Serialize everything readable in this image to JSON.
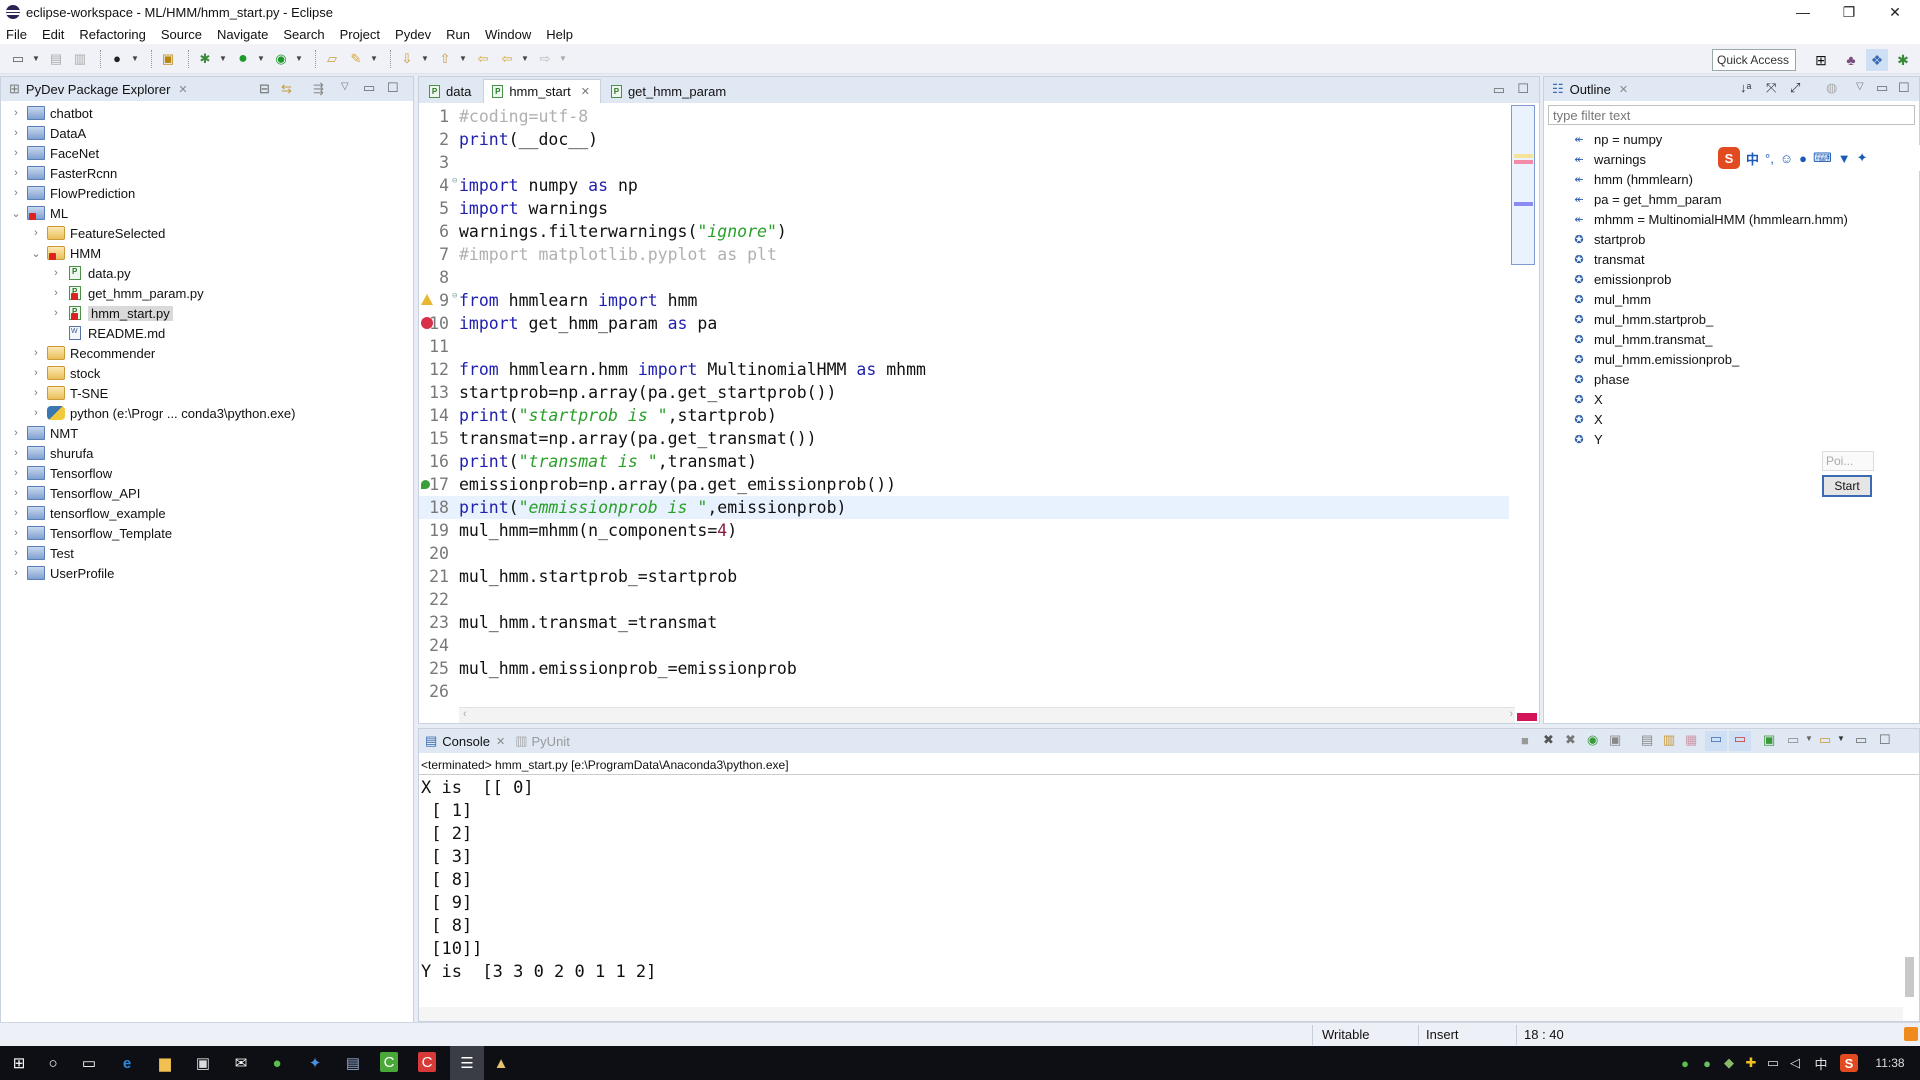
{
  "window": {
    "title": "eclipse-workspace - ML/HMM/hmm_start.py - Eclipse",
    "minimize": "—",
    "restore": "❐",
    "close": "✕"
  },
  "menu": [
    "File",
    "Edit",
    "Refactoring",
    "Source",
    "Navigate",
    "Search",
    "Project",
    "Pydev",
    "Run",
    "Window",
    "Help"
  ],
  "toolbar": {
    "quick_access": "Quick Access"
  },
  "explorer": {
    "title": "PyDev Package Explorer",
    "items": [
      {
        "label": "chatbot",
        "depth": 0,
        "type": "proj",
        "expanded": false
      },
      {
        "label": "DataA",
        "depth": 0,
        "type": "proj",
        "expanded": false
      },
      {
        "label": "FaceNet",
        "depth": 0,
        "type": "proj",
        "expanded": false
      },
      {
        "label": "FasterRcnn",
        "depth": 0,
        "type": "proj",
        "expanded": false
      },
      {
        "label": "FlowPrediction",
        "depth": 0,
        "type": "proj",
        "expanded": false
      },
      {
        "label": "ML",
        "depth": 0,
        "type": "proj",
        "expanded": true,
        "error": true
      },
      {
        "label": "FeatureSelected",
        "depth": 1,
        "type": "folder",
        "expanded": false
      },
      {
        "label": "HMM",
        "depth": 1,
        "type": "folder",
        "expanded": true,
        "error": true
      },
      {
        "label": "data.py",
        "depth": 2,
        "type": "pyfile",
        "expanded": false
      },
      {
        "label": "get_hmm_param.py",
        "depth": 2,
        "type": "pyfile",
        "expanded": false,
        "error": true
      },
      {
        "label": "hmm_start.py",
        "depth": 2,
        "type": "pyfile",
        "expanded": false,
        "error": true,
        "selected": true
      },
      {
        "label": "README.md",
        "depth": 2,
        "type": "mdfile",
        "leaf": true
      },
      {
        "label": "Recommender",
        "depth": 1,
        "type": "folder",
        "expanded": false
      },
      {
        "label": "stock",
        "depth": 1,
        "type": "folder",
        "expanded": false
      },
      {
        "label": "T-SNE",
        "depth": 1,
        "type": "folder",
        "expanded": false
      },
      {
        "label": "python  (e:\\Progr ... conda3\\python.exe)",
        "depth": 1,
        "type": "python",
        "expanded": false
      },
      {
        "label": "NMT",
        "depth": 0,
        "type": "proj",
        "expanded": false
      },
      {
        "label": "shurufa",
        "depth": 0,
        "type": "proj",
        "expanded": false
      },
      {
        "label": "Tensorflow",
        "depth": 0,
        "type": "proj",
        "expanded": false
      },
      {
        "label": "Tensorflow_API",
        "depth": 0,
        "type": "proj",
        "expanded": false
      },
      {
        "label": "tensorflow_example",
        "depth": 0,
        "type": "proj",
        "expanded": false
      },
      {
        "label": "Tensorflow_Template",
        "depth": 0,
        "type": "proj",
        "expanded": false
      },
      {
        "label": "Test",
        "depth": 0,
        "type": "proj",
        "expanded": false
      },
      {
        "label": "UserProfile",
        "depth": 0,
        "type": "proj",
        "expanded": false
      }
    ]
  },
  "editor": {
    "tabs": [
      {
        "label": "data",
        "active": false
      },
      {
        "label": "hmm_start",
        "active": true,
        "closable": true
      },
      {
        "label": "get_hmm_param",
        "active": false
      }
    ],
    "lines": [
      {
        "n": "1",
        "tokens": [
          [
            "cmt",
            "#coding=utf-8"
          ]
        ]
      },
      {
        "n": "2",
        "tokens": [
          [
            "kw",
            "print"
          ],
          [
            "",
            "(__doc__)"
          ]
        ]
      },
      {
        "n": "3",
        "tokens": []
      },
      {
        "n": "4",
        "fold": true,
        "tokens": [
          [
            "kw",
            "import"
          ],
          [
            "",
            " numpy "
          ],
          [
            "kw",
            "as"
          ],
          [
            "",
            " np"
          ]
        ]
      },
      {
        "n": "5",
        "tokens": [
          [
            "kw",
            "import"
          ],
          [
            "",
            " warnings"
          ]
        ]
      },
      {
        "n": "6",
        "tokens": [
          [
            "",
            "warnings.filterwarnings("
          ],
          [
            "str",
            "\"ignore\""
          ],
          [
            "",
            ")"
          ]
        ]
      },
      {
        "n": "7",
        "tokens": [
          [
            "cmt",
            "#import matplotlib.pyplot as plt"
          ]
        ]
      },
      {
        "n": "8",
        "tokens": []
      },
      {
        "n": "9",
        "fold": true,
        "ann": "warning",
        "tokens": [
          [
            "kw",
            "from"
          ],
          [
            "",
            " hmmlearn "
          ],
          [
            "kw",
            "import"
          ],
          [
            "",
            " hmm"
          ]
        ]
      },
      {
        "n": "10",
        "ann": "error",
        "tokens": [
          [
            "kw",
            "import"
          ],
          [
            "",
            " get_hmm_param "
          ],
          [
            "kw",
            "as"
          ],
          [
            "",
            " pa"
          ]
        ]
      },
      {
        "n": "11",
        "tokens": []
      },
      {
        "n": "12",
        "tokens": [
          [
            "kw",
            "from"
          ],
          [
            "",
            " hmmlearn.hmm "
          ],
          [
            "kw",
            "import"
          ],
          [
            "",
            " MultinomialHMM "
          ],
          [
            "kw",
            "as"
          ],
          [
            "",
            " mhmm"
          ]
        ]
      },
      {
        "n": "13",
        "tokens": [
          [
            "",
            "startprob=np.array(pa.get_startprob())"
          ]
        ]
      },
      {
        "n": "14",
        "tokens": [
          [
            "kw",
            "print"
          ],
          [
            "",
            "("
          ],
          [
            "str",
            "\"startprob is \""
          ],
          [
            "",
            ",startprob)"
          ]
        ]
      },
      {
        "n": "15",
        "tokens": [
          [
            "",
            "transmat=np.array(pa.get_transmat())"
          ]
        ]
      },
      {
        "n": "16",
        "tokens": [
          [
            "kw",
            "print"
          ],
          [
            "",
            "("
          ],
          [
            "str",
            "\"transmat is \""
          ],
          [
            "",
            ",transmat)"
          ]
        ]
      },
      {
        "n": "17",
        "ann": "change",
        "tokens": [
          [
            "",
            "emissionprob=np.array(pa.get_emissionprob())"
          ]
        ]
      },
      {
        "n": "18",
        "current": true,
        "tokens": [
          [
            "kw",
            "print"
          ],
          [
            "",
            "("
          ],
          [
            "str",
            "\"emmissionprob is \""
          ],
          [
            "",
            ",emissionprob)"
          ]
        ]
      },
      {
        "n": "19",
        "tokens": [
          [
            "",
            "mul_hmm=mhmm(n_components="
          ],
          [
            "num",
            "4"
          ],
          [
            "",
            ")"
          ]
        ]
      },
      {
        "n": "20",
        "tokens": []
      },
      {
        "n": "21",
        "tokens": [
          [
            "",
            "mul_hmm.startprob_=startprob"
          ]
        ]
      },
      {
        "n": "22",
        "tokens": []
      },
      {
        "n": "23",
        "tokens": [
          [
            "",
            "mul_hmm.transmat_=transmat"
          ]
        ]
      },
      {
        "n": "24",
        "tokens": []
      },
      {
        "n": "25",
        "tokens": [
          [
            "",
            "mul_hmm.emissionprob_=emissionprob"
          ]
        ]
      },
      {
        "n": "26",
        "tokens": []
      }
    ]
  },
  "outline": {
    "title": "Outline",
    "filter_placeholder": "type filter text",
    "items": [
      {
        "label": "np = numpy",
        "kind": "import"
      },
      {
        "label": "warnings",
        "kind": "import"
      },
      {
        "label": "hmm (hmmlearn)",
        "kind": "import"
      },
      {
        "label": "pa = get_hmm_param",
        "kind": "import"
      },
      {
        "label": "mhmm = MultinomialHMM (hmmlearn.hmm)",
        "kind": "import"
      },
      {
        "label": "startprob",
        "kind": "var"
      },
      {
        "label": "transmat",
        "kind": "var"
      },
      {
        "label": "emissionprob",
        "kind": "var"
      },
      {
        "label": "mul_hmm",
        "kind": "var"
      },
      {
        "label": "mul_hmm.startprob_",
        "kind": "var"
      },
      {
        "label": "mul_hmm.transmat_",
        "kind": "var"
      },
      {
        "label": "mul_hmm.emissionprob_",
        "kind": "var"
      },
      {
        "label": "phase",
        "kind": "var"
      },
      {
        "label": "X",
        "kind": "var"
      },
      {
        "label": "X",
        "kind": "var"
      },
      {
        "label": "Y",
        "kind": "var"
      }
    ],
    "ime_toolbar": [
      "S",
      "中",
      "°,",
      "☺",
      "🎤",
      "⌨",
      "👕",
      "🔧"
    ],
    "popup": {
      "field": "Poi...",
      "button": "Start"
    }
  },
  "console": {
    "tabs": [
      {
        "label": "Console",
        "active": true
      },
      {
        "label": "PyUnit",
        "active": false
      }
    ],
    "terminated": "<terminated> hmm_start.py [e:\\ProgramData\\Anaconda3\\python.exe]",
    "output": "X is  [[ 0]\n [ 1]\n [ 2]\n [ 3]\n [ 8]\n [ 9]\n [ 8]\n [10]]\nY is  [3 3 0 2 0 1 1 2]"
  },
  "status": {
    "writable": "Writable",
    "mode": "Insert",
    "position": "18 : 40"
  },
  "taskbar": {
    "clock": "11:38",
    "ime": "中"
  },
  "colors": {
    "keyword": "#2020b0",
    "string": "#2aa02a",
    "comment": "#b0b0b0",
    "number": "#8b1e3f",
    "current_line": "#e8f2fe",
    "panel_header": "#dfe8f3"
  }
}
